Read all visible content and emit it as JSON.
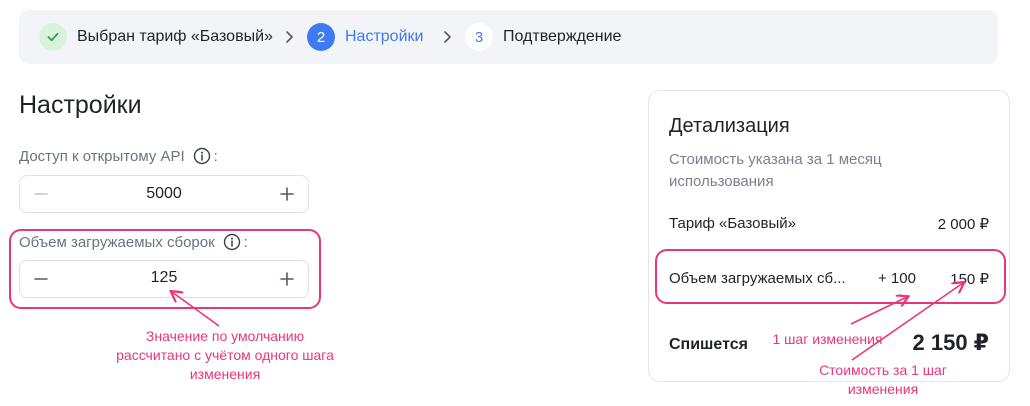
{
  "stepper": {
    "steps": [
      {
        "number": "",
        "label": "Выбран тариф «Базовый»",
        "state": "done"
      },
      {
        "number": "2",
        "label": "Настройки",
        "state": "active"
      },
      {
        "number": "3",
        "label": "Подтверждение",
        "state": "todo"
      }
    ]
  },
  "settings": {
    "title": "Настройки",
    "api_access": {
      "label": "Доступ к открытому API",
      "colon": ":",
      "value": "5000"
    },
    "builds_volume": {
      "label": "Объем загружаемых сборок",
      "colon": ":",
      "value": "125"
    }
  },
  "annotations": {
    "default_value": "Значение по умолчанию рассчитано с учётом одного шага изменения",
    "step_change": "1 шаг изменения",
    "step_cost": "Стоимость за 1 шаг изменения"
  },
  "details": {
    "title": "Детализация",
    "subtitle": "Стоимость указана за 1 месяц использования",
    "tariff_label": "Тариф «Базовый»",
    "tariff_price": "2 000 ₽",
    "builds_label": "Объем загружаемых сб...",
    "builds_step": "+ 100",
    "builds_price": "150 ₽",
    "total_label": "Спишется",
    "total_value": "2 150 ₽"
  },
  "colors": {
    "accent": "#3e7af0",
    "annotation": "#e9367a",
    "success": "#2e9e48"
  }
}
